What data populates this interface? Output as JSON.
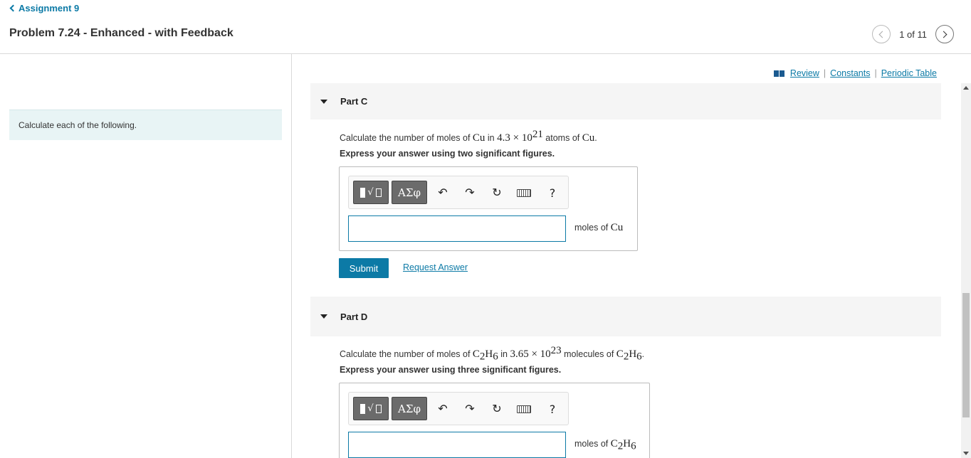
{
  "header": {
    "back_label": "Assignment 9",
    "title": "Problem 7.24 - Enhanced - with Feedback",
    "page_count": "1 of 11"
  },
  "left_panel": {
    "instruction": "Calculate each of the following."
  },
  "resources": {
    "review": "Review",
    "constants": "Constants",
    "periodic_table": "Periodic Table",
    "separator": "|"
  },
  "toolbar": {
    "greek_label": "ΑΣφ",
    "help_label": "?"
  },
  "part_c": {
    "label": "Part C",
    "question": {
      "pre": "Calculate the number of moles of ",
      "subject": "Cu",
      "mid1": " in ",
      "coef": "4.3",
      "times": " × ",
      "base": "10",
      "exp": "21",
      "mid2": " atoms of ",
      "subject2": "Cu",
      "end": "."
    },
    "instruction": "Express your answer using two significant figures.",
    "answer_value": "",
    "unit_prefix": "moles of ",
    "unit_formula": "Cu",
    "submit_label": "Submit",
    "request_label": "Request Answer"
  },
  "part_d": {
    "label": "Part D",
    "question": {
      "pre": "Calculate the number of moles of ",
      "c": "C",
      "c_sub": "2",
      "h": "H",
      "h_sub": "6",
      "mid1": " in ",
      "coef": "3.65",
      "times": " × ",
      "base": "10",
      "exp": "23",
      "mid2": " molecules of ",
      "end": "."
    },
    "instruction": "Express your answer using three significant figures.",
    "answer_value": "",
    "unit_prefix": "moles of ",
    "unit_c": "C",
    "unit_c_sub": "2",
    "unit_h": "H",
    "unit_h_sub": "6"
  },
  "colors": {
    "accent": "#0c7aa6",
    "instruction_bg": "#e8f4f5",
    "part_header_bg": "#f5f5f5"
  }
}
